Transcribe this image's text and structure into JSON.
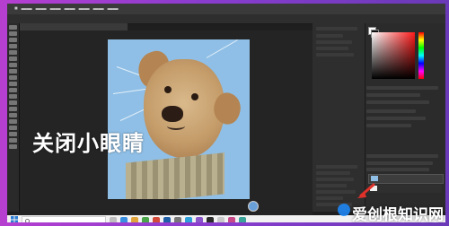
{
  "overlay": {
    "title": "关闭小眼睛"
  },
  "watermark": {
    "text": "爱创根知识网"
  },
  "document": {
    "tab_title": "",
    "layer_name": ""
  },
  "taskbar": {
    "search_placeholder": ""
  },
  "colors": {
    "accent_red": "#e0312b",
    "sky": "#8fbfe6",
    "ps_dark": "#1f1f1f"
  },
  "icons": [
    "windows-start-icon",
    "search-icon",
    "eye-icon",
    "layer-thumbnail-icon",
    "arrow-icon"
  ]
}
